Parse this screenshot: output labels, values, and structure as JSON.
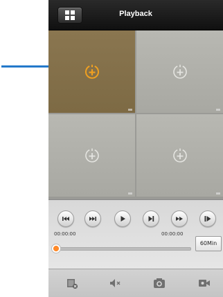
{
  "header": {
    "title": "Playback"
  },
  "grid": {
    "cells": [
      {
        "state": "selected",
        "icon": "add-channel-icon"
      },
      {
        "state": "empty",
        "icon": "add-channel-icon"
      },
      {
        "state": "empty",
        "icon": "add-channel-icon"
      },
      {
        "state": "empty",
        "icon": "add-channel-icon"
      }
    ]
  },
  "controls": {
    "buttons": [
      "skip-to-start-icon",
      "frame-back-icon",
      "play-icon",
      "step-forward-icon",
      "fast-forward-icon",
      "skip-to-end-icon"
    ],
    "start_time": "00:00:00",
    "end_time": "00:00:00",
    "range_label": "60Min",
    "progress": 0
  },
  "toolbar": {
    "items": [
      "stop-icon",
      "mute-icon",
      "snapshot-icon",
      "record-icon"
    ]
  },
  "colors": {
    "accent": "#f0a020",
    "selected_cell": "#7d6a44",
    "arrow": "#1a73c8",
    "knob": "#ff8a2a"
  }
}
